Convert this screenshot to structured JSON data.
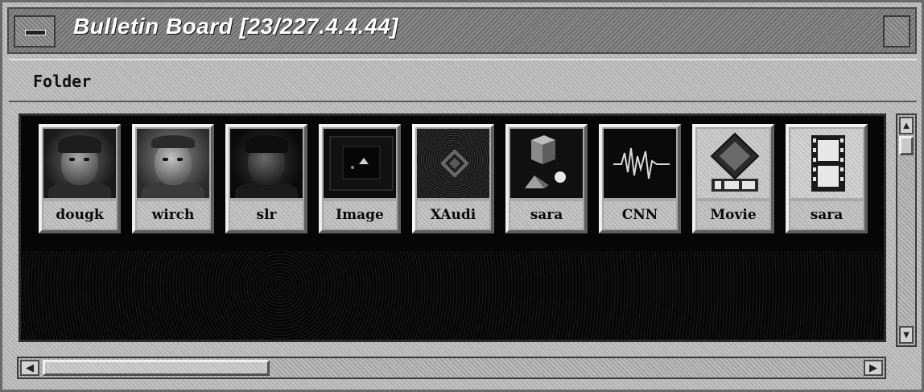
{
  "window": {
    "title": "Bulletin Board [23/227.4.4.44]"
  },
  "menubar": {
    "items": [
      {
        "label": "Folder"
      }
    ]
  },
  "icons": [
    {
      "label": "dougk",
      "icon": "person-photo-icon"
    },
    {
      "label": "wirch",
      "icon": "person-photo-icon"
    },
    {
      "label": "slr",
      "icon": "person-photo-icon"
    },
    {
      "label": "Image",
      "icon": "image-viewer-icon"
    },
    {
      "label": "XAudi",
      "icon": "audio-icon"
    },
    {
      "label": "sara",
      "icon": "geometric-shapes-icon"
    },
    {
      "label": "CNN",
      "icon": "waveform-icon"
    },
    {
      "label": "Movie",
      "icon": "film-reel-icon"
    },
    {
      "label": "sara",
      "icon": "film-strip-icon"
    }
  ],
  "colors": {
    "icon_area_background": "#060606",
    "window_chrome": "#b8b8b8",
    "title_text": "#ffffff"
  }
}
